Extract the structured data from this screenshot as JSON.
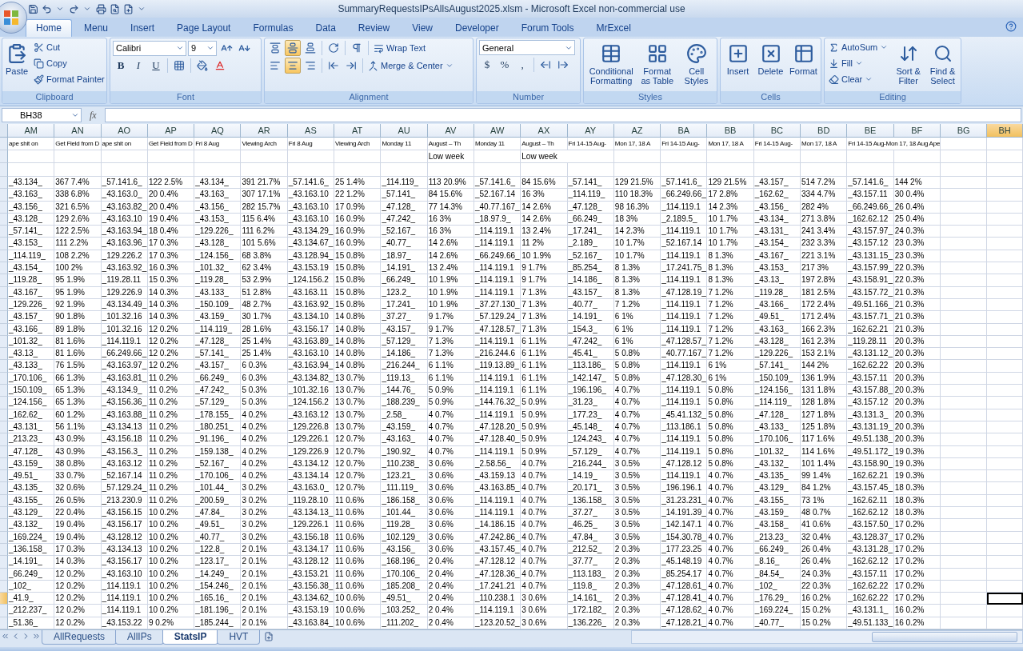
{
  "title_bar": {
    "title": "SummaryRequestsIPsAllsAugust2025.xlsm - Microsoft Excel non-commercial use"
  },
  "ribbon_tabs": [
    {
      "label": "Home",
      "selected": true
    },
    {
      "label": "Menu",
      "selected": false
    },
    {
      "label": "Insert",
      "selected": false
    },
    {
      "label": "Page Layout",
      "selected": false
    },
    {
      "label": "Formulas",
      "selected": false
    },
    {
      "label": "Data",
      "selected": false
    },
    {
      "label": "Review",
      "selected": false
    },
    {
      "label": "View",
      "selected": false
    },
    {
      "label": "Developer",
      "selected": false
    },
    {
      "label": "Forum Tools",
      "selected": false
    },
    {
      "label": "MrExcel",
      "selected": false
    }
  ],
  "ribbon": {
    "clipboard": {
      "paste": "Paste",
      "cut": "Cut",
      "copy": "Copy",
      "format_painter": "Format Painter",
      "label": "Clipboard"
    },
    "font": {
      "font_name": "Calibri",
      "font_size": "9",
      "style_buttons": [
        "B",
        "I",
        "U"
      ],
      "label": "Font"
    },
    "alignment": {
      "vertical_align": [
        {
          "selected": false
        },
        {
          "selected": true
        },
        {
          "selected": false
        }
      ],
      "horizontal_align": [
        {
          "selected": false
        },
        {
          "selected": true
        },
        {
          "selected": false
        }
      ],
      "wrap_text": "Wrap Text",
      "merge_center": "Merge & Center",
      "label": "Alignment"
    },
    "number": {
      "format": "General",
      "symbols": [
        "$",
        "%",
        ","
      ],
      "label": "Number"
    },
    "styles": {
      "buttons": [
        "Conditional Formatting",
        "Format as Table",
        "Cell Styles"
      ],
      "label": "Styles"
    },
    "cells": {
      "buttons": [
        "Insert",
        "Delete",
        "Format"
      ],
      "label": "Cells"
    },
    "editing": {
      "small": [
        "AutoSum",
        "Fill",
        "Clear"
      ],
      "large": [
        "Sort & Filter",
        "Find & Select"
      ],
      "label": "Editing"
    }
  },
  "formula_bar": {
    "name_box": "BH38",
    "fx": "fx"
  },
  "columns": [
    {
      "label": "AM",
      "selected": false
    },
    {
      "label": "AN",
      "selected": false
    },
    {
      "label": "AO",
      "selected": false
    },
    {
      "label": "AP",
      "selected": false
    },
    {
      "label": "AQ",
      "selected": false
    },
    {
      "label": "AR",
      "selected": false
    },
    {
      "label": "AS",
      "selected": false
    },
    {
      "label": "AT",
      "selected": false
    },
    {
      "label": "AU",
      "selected": false
    },
    {
      "label": "AV",
      "selected": false
    },
    {
      "label": "AW",
      "selected": false
    },
    {
      "label": "AX",
      "selected": false
    },
    {
      "label": "AY",
      "selected": false
    },
    {
      "label": "AZ",
      "selected": false
    },
    {
      "label": "BA",
      "selected": false
    },
    {
      "label": "BB",
      "selected": false
    },
    {
      "label": "BC",
      "selected": false
    },
    {
      "label": "BD",
      "selected": false
    },
    {
      "label": "BE",
      "selected": false
    },
    {
      "label": "BF",
      "selected": false
    },
    {
      "label": "BG",
      "selected": false
    },
    {
      "label": "BH",
      "selected": true
    }
  ],
  "header_rows": [
    {
      "cells": [
        "ape shit on",
        "Get Field from D",
        "ape shit on",
        "Get Field from D",
        "Fri 8 Aug",
        "Viewing Arch",
        "Fri 8 Aug",
        "Viewing Arch",
        "Monday 11",
        "August – Th",
        "Monday 11",
        "August – Th",
        "Fri 14-15 Aug-",
        "Mon 17, 18 A",
        "Fri 14-15 Aug-",
        "Mon 17, 18 A",
        "Fri 14-15 Aug-",
        "Mon 17, 18 A",
        "Fri 14-15 Aug-Mon 17, 18 Aug Ape"
      ]
    },
    {
      "cells": [
        null,
        null,
        null,
        null,
        null,
        null,
        null,
        null,
        null,
        "Low week",
        null,
        "Low week"
      ]
    }
  ],
  "rows": [
    {
      "selected": false,
      "cells": [
        "_43.134_",
        "367 7.4%",
        "_57.141.6_",
        "122 2.5%",
        "_43.134_",
        "391 21.7%",
        "_57.141.6_",
        "25 1.4%",
        "_114.119_",
        "113 20.9%",
        "_57.141.6_",
        "84 15.6%",
        "_57.141_",
        "129 21.5%",
        "_57.141.6_",
        "129 21.5%",
        "_43.157_",
        "514 7.2%",
        "_57.141.6_",
        "144 2%"
      ]
    },
    {
      "selected": false,
      "cells": [
        "_43.163_",
        "338 6.8%",
        "_43.163.0_",
        "20 0.4%",
        "_43.163_",
        "307 17.1%",
        "_43.163.10",
        "22 1.2%",
        "_57.141_",
        "84 15.6%",
        "_52.167.14",
        "16 3%",
        "_114.119_",
        "110 18.3%",
        "_66.249.66_",
        "17 2.8%",
        "_162.62_",
        "334 4.7%",
        "_43.157.11",
        "30 0.4%"
      ]
    },
    {
      "selected": false,
      "cells": [
        "_43.156_",
        "321 6.5%",
        "_43.163.82_",
        "20 0.4%",
        "_43.156_",
        "282 15.7%",
        "_43.163.10",
        "17 0.9%",
        "_47.128_",
        "77 14.3%",
        "_40.77.167_",
        "14 2.6%",
        "_47.128_",
        "98 16.3%",
        "_114.119.1",
        "14 2.3%",
        "_43.156_",
        "282 4%",
        "_66.249.66_",
        "26 0.4%"
      ]
    },
    {
      "selected": false,
      "cells": [
        "_43.128_",
        "129 2.6%",
        "_43.163.10",
        "19 0.4%",
        "_43.153_",
        "115 6.4%",
        "_43.163.10",
        "16 0.9%",
        "_47.242_",
        "16 3%",
        "_18.97.9_",
        "14 2.6%",
        "_66.249_",
        "18 3%",
        "_2.189.5_",
        "10 1.7%",
        "_43.134_",
        "271 3.8%",
        "_162.62.12",
        "25 0.4%"
      ]
    },
    {
      "selected": false,
      "cells": [
        "_57.141_",
        "122 2.5%",
        "_43.163.94_",
        "18 0.4%",
        "_129.226_",
        "111 6.2%",
        "_43.134.29_",
        "16 0.9%",
        "_52.167_",
        "16 3%",
        "_114.119.1",
        "13 2.4%",
        "_17.241_",
        "14 2.3%",
        "_114.119.1",
        "10 1.7%",
        "_43.131_",
        "241 3.4%",
        "_43.157.97_",
        "24 0.3%"
      ]
    },
    {
      "selected": false,
      "cells": [
        "_43.153_",
        "111 2.2%",
        "_43.163.96_",
        "17 0.3%",
        "_43.128_",
        "101 5.6%",
        "_43.134.67_",
        "16 0.9%",
        "_40.77_",
        "14 2.6%",
        "_114.119.1",
        "11 2%",
        "_2.189_",
        "10 1.7%",
        "_52.167.14",
        "10 1.7%",
        "_43.154_",
        "232 3.3%",
        "_43.157.12",
        "23 0.3%"
      ]
    },
    {
      "selected": false,
      "cells": [
        "_114.119_",
        "108 2.2%",
        "_129.226.2",
        "17 0.3%",
        "_124.156_",
        "68 3.8%",
        "_43.128.94_",
        "15 0.8%",
        "_18.97_",
        "14 2.6%",
        "_66.249.66_",
        "10 1.9%",
        "_52.167_",
        "10 1.7%",
        "_114.119.1",
        "8 1.3%",
        "_43.167_",
        "221 3.1%",
        "_43.131.15_",
        "23 0.3%"
      ]
    },
    {
      "selected": false,
      "cells": [
        "_43.154_",
        "100 2%",
        "_43.163.92_",
        "16 0.3%",
        "_101.32_",
        "62 3.4%",
        "_43.153.19",
        "15 0.8%",
        "_14.191_",
        "13 2.4%",
        "_114.119.1",
        "9 1.7%",
        "_85.254_",
        "8 1.3%",
        "_17.241.75_",
        "8 1.3%",
        "_43.153_",
        "217 3%",
        "_43.157.99_",
        "22 0.3%"
      ]
    },
    {
      "selected": false,
      "cells": [
        "_119.28_",
        "95 1.9%",
        "_119.28.11",
        "15 0.3%",
        "_119.28_",
        "53 2.9%",
        "_124.156.2",
        "15 0.8%",
        "_66.249_",
        "10 1.9%",
        "_114.119.1",
        "9 1.7%",
        "_14.186_",
        "8 1.3%",
        "_114.119.1",
        "8 1.3%",
        "_43.13_",
        "197 2.8%",
        "_43.158.91_",
        "22 0.3%"
      ]
    },
    {
      "selected": false,
      "cells": [
        "_43.167_",
        "95 1.9%",
        "_129.226.9",
        "14 0.3%",
        "_43.133_",
        "51 2.8%",
        "_43.163.11",
        "15 0.8%",
        "_123.2_",
        "10 1.9%",
        "_114.119.1",
        "7 1.3%",
        "_43.157_",
        "8 1.3%",
        "_47.128.19_",
        "7 1.2%",
        "_119.28_",
        "181 2.5%",
        "_43.157.72_",
        "21 0.3%"
      ]
    },
    {
      "selected": false,
      "cells": [
        "_129.226_",
        "92 1.9%",
        "_43.134.49_",
        "14 0.3%",
        "_150.109_",
        "48 2.7%",
        "_43.163.92_",
        "15 0.8%",
        "_17.241_",
        "10 1.9%",
        "_37.27.130_",
        "7 1.3%",
        "_40.77_",
        "7 1.2%",
        "_114.119.1",
        "7 1.2%",
        "_43.166_",
        "172 2.4%",
        "_49.51.166_",
        "21 0.3%"
      ]
    },
    {
      "selected": false,
      "cells": [
        "_43.157_",
        "90 1.8%",
        "_101.32.16",
        "14 0.3%",
        "_43.159_",
        "30 1.7%",
        "_43.134.10",
        "14 0.8%",
        "_37.27_",
        "9 1.7%",
        "_57.129.24_",
        "7 1.3%",
        "_14.191_",
        "6 1%",
        "_114.119.1",
        "7 1.2%",
        "_49.51_",
        "171 2.4%",
        "_43.157.71_",
        "21 0.3%"
      ]
    },
    {
      "selected": false,
      "cells": [
        "_43.166_",
        "89 1.8%",
        "_101.32.16",
        "12 0.2%",
        "_114.119_",
        "28 1.6%",
        "_43.156.17",
        "14 0.8%",
        "_43.157_",
        "9 1.7%",
        "_47.128.57_",
        "7 1.3%",
        "_154.3_",
        "6 1%",
        "_114.119.1",
        "7 1.2%",
        "_43.163_",
        "166 2.3%",
        "_162.62.21",
        "21 0.3%"
      ]
    },
    {
      "selected": false,
      "cells": [
        "_101.32_",
        "81 1.6%",
        "_114.119.1",
        "12 0.2%",
        "_47.128_",
        "25 1.4%",
        "_43.163.89_",
        "14 0.8%",
        "_57.129_",
        "7 1.3%",
        "_114.119.1",
        "6 1.1%",
        "_47.242_",
        "6 1%",
        "_47.128.57_",
        "7 1.2%",
        "_43.128_",
        "161 2.3%",
        "_119.28.11",
        "20 0.3%"
      ]
    },
    {
      "selected": false,
      "cells": [
        "_43.13_",
        "81 1.6%",
        "_66.249.66_",
        "12 0.2%",
        "_57.141_",
        "25 1.4%",
        "_43.163.10",
        "14 0.8%",
        "_14.186_",
        "7 1.3%",
        "_216.244.6",
        "6 1.1%",
        "_45.41_",
        "5 0.8%",
        "_40.77.167_",
        "7 1.2%",
        "_129.226_",
        "153 2.1%",
        "_43.131.12_",
        "20 0.3%"
      ]
    },
    {
      "selected": false,
      "cells": [
        "_43.133_",
        "76 1.5%",
        "_43.163.97_",
        "12 0.2%",
        "_43.157_",
        "6 0.3%",
        "_43.163.94_",
        "14 0.8%",
        "_216.244_",
        "6 1.1%",
        "_119.13.89_",
        "6 1.1%",
        "_113.186_",
        "5 0.8%",
        "_114.119.1",
        "6 1%",
        "_57.141_",
        "144 2%",
        "_162.62.22",
        "20 0.3%"
      ]
    },
    {
      "selected": false,
      "cells": [
        "_170.106_",
        "66 1.3%",
        "_43.163.81_",
        "11 0.2%",
        "_66.249_",
        "6 0.3%",
        "_43.134.82_",
        "13 0.7%",
        "_119.13_",
        "6 1.1%",
        "_114.119.1",
        "6 1.1%",
        "_142.147_",
        "5 0.8%",
        "_47.128.30_",
        "6 1%",
        "_150.109_",
        "136 1.9%",
        "_43.157.11",
        "20 0.3%"
      ]
    },
    {
      "selected": false,
      "cells": [
        "_150.109_",
        "65 1.3%",
        "_43.134.9_",
        "11 0.2%",
        "_47.242_",
        "5 0.3%",
        "_101.32.16",
        "13 0.7%",
        "_144.76_",
        "5 0.9%",
        "_114.119.1",
        "6 1.1%",
        "_196.196_",
        "4 0.7%",
        "_114.119.1",
        "5 0.8%",
        "_124.156_",
        "131 1.8%",
        "_43.157.88_",
        "20 0.3%"
      ]
    },
    {
      "selected": false,
      "cells": [
        "_124.156_",
        "65 1.3%",
        "_43.156.36_",
        "11 0.2%",
        "_57.129_",
        "5 0.3%",
        "_124.156.2",
        "13 0.7%",
        "_188.239_",
        "5 0.9%",
        "_144.76.32_",
        "5 0.9%",
        "_31.23_",
        "4 0.7%",
        "_114.119.1",
        "5 0.8%",
        "_114.119_",
        "128 1.8%",
        "_43.157.12",
        "20 0.3%"
      ]
    },
    {
      "selected": false,
      "cells": [
        "_162.62_",
        "60 1.2%",
        "_43.163.88_",
        "11 0.2%",
        "_178.155_",
        "4 0.2%",
        "_43.163.12",
        "13 0.7%",
        "_2.58_",
        "4 0.7%",
        "_114.119.1",
        "5 0.9%",
        "_177.23_",
        "4 0.7%",
        "_45.41.132_",
        "5 0.8%",
        "_47.128_",
        "127 1.8%",
        "_43.131.3_",
        "20 0.3%"
      ]
    },
    {
      "selected": false,
      "cells": [
        "_43.131_",
        "56 1.1%",
        "_43.134.13",
        "11 0.2%",
        "_180.251_",
        "4 0.2%",
        "_129.226.8",
        "13 0.7%",
        "_43.159_",
        "4 0.7%",
        "_47.128.20_",
        "5 0.9%",
        "_45.148_",
        "4 0.7%",
        "_113.186.1",
        "5 0.8%",
        "_43.133_",
        "125 1.8%",
        "_43.131.19_",
        "20 0.3%"
      ]
    },
    {
      "selected": false,
      "cells": [
        "_213.23_",
        "43 0.9%",
        "_43.156.18",
        "11 0.2%",
        "_91.196_",
        "4 0.2%",
        "_129.226.1",
        "12 0.7%",
        "_43.163_",
        "4 0.7%",
        "_47.128.40_",
        "5 0.9%",
        "_124.243_",
        "4 0.7%",
        "_114.119.1",
        "5 0.8%",
        "_170.106_",
        "117 1.6%",
        "_49.51.138_",
        "20 0.3%"
      ]
    },
    {
      "selected": false,
      "cells": [
        "_47.128_",
        "43 0.9%",
        "_43.156.3_",
        "11 0.2%",
        "_159.138_",
        "4 0.2%",
        "_129.226.9",
        "12 0.7%",
        "_190.92_",
        "4 0.7%",
        "_114.119.1",
        "5 0.9%",
        "_57.129_",
        "4 0.7%",
        "_114.119.1",
        "5 0.8%",
        "_101.32_",
        "114 1.6%",
        "_49.51.172_",
        "19 0.3%"
      ]
    },
    {
      "selected": false,
      "cells": [
        "_43.159_",
        "38 0.8%",
        "_43.163.12",
        "11 0.2%",
        "_52.167_",
        "4 0.2%",
        "_43.134.12",
        "12 0.7%",
        "_110.238_",
        "3 0.6%",
        "_2.58.56_",
        "4 0.7%",
        "_216.244_",
        "3 0.5%",
        "_47.128.12",
        "5 0.8%",
        "_43.132_",
        "101 1.4%",
        "_43.158.90_",
        "19 0.3%"
      ]
    },
    {
      "selected": false,
      "cells": [
        "_49.51_",
        "33 0.7%",
        "_52.167.14",
        "11 0.2%",
        "_170.106_",
        "4 0.2%",
        "_43.134.14",
        "12 0.7%",
        "_123.21_",
        "3 0.6%",
        "_43.159.13",
        "4 0.7%",
        "_14.19_",
        "3 0.5%",
        "_114.119.1",
        "4 0.7%",
        "_43.135_",
        "99 1.4%",
        "_162.62.21",
        "19 0.3%"
      ]
    },
    {
      "selected": false,
      "cells": [
        "_43.135_",
        "32 0.6%",
        "_57.129.24_",
        "11 0.2%",
        "_101.44_",
        "3 0.2%",
        "_43.163.0_",
        "12 0.7%",
        "_111.119_",
        "3 0.6%",
        "_43.163.85_",
        "4 0.7%",
        "_20.171_",
        "3 0.5%",
        "_196.196.1",
        "4 0.7%",
        "_43.129_",
        "84 1.2%",
        "_43.157.45_",
        "18 0.3%"
      ]
    },
    {
      "selected": false,
      "cells": [
        "_43.155_",
        "26 0.5%",
        "_213.230.9",
        "11 0.2%",
        "_200.59_",
        "3 0.2%",
        "_119.28.10",
        "11 0.6%",
        "_186.158_",
        "3 0.6%",
        "_114.119.1",
        "4 0.7%",
        "_136.158_",
        "3 0.5%",
        "_31.23.231_",
        "4 0.7%",
        "_43.155_",
        "73 1%",
        "_162.62.11",
        "18 0.3%"
      ]
    },
    {
      "selected": false,
      "cells": [
        "_43.129_",
        "22 0.4%",
        "_43.156.15",
        "10 0.2%",
        "_47.84_",
        "3 0.2%",
        "_43.134.13_",
        "11 0.6%",
        "_101.44_",
        "3 0.6%",
        "_114.119.1",
        "4 0.7%",
        "_37.27_",
        "3 0.5%",
        "_14.191.39_",
        "4 0.7%",
        "_43.159_",
        "48 0.7%",
        "_162.62.12",
        "18 0.3%"
      ]
    },
    {
      "selected": false,
      "cells": [
        "_43.132_",
        "19 0.4%",
        "_43.156.17",
        "10 0.2%",
        "_49.51_",
        "3 0.2%",
        "_129.226.1",
        "11 0.6%",
        "_119.28_",
        "3 0.6%",
        "_14.186.15",
        "4 0.7%",
        "_46.25_",
        "3 0.5%",
        "_142.147.1",
        "4 0.7%",
        "_43.158_",
        "41 0.6%",
        "_43.157.50_",
        "17 0.2%"
      ]
    },
    {
      "selected": false,
      "cells": [
        "_169.224_",
        "19 0.4%",
        "_43.128.12",
        "10 0.2%",
        "_40.77_",
        "3 0.2%",
        "_43.156.18",
        "11 0.6%",
        "_102.129_",
        "3 0.6%",
        "_47.242.86_",
        "4 0.7%",
        "_47.84_",
        "3 0.5%",
        "_154.30.78_",
        "4 0.7%",
        "_213.23_",
        "32 0.4%",
        "_43.128.37_",
        "17 0.2%"
      ]
    },
    {
      "selected": false,
      "cells": [
        "_136.158_",
        "17 0.3%",
        "_43.134.13",
        "10 0.2%",
        "_122.8_",
        "2 0.1%",
        "_43.134.17",
        "11 0.6%",
        "_43.156_",
        "3 0.6%",
        "_43.157.45_",
        "4 0.7%",
        "_212.52_",
        "2 0.3%",
        "_177.23.25",
        "4 0.7%",
        "_66.249_",
        "26 0.4%",
        "_43.131.28_",
        "17 0.2%"
      ]
    },
    {
      "selected": false,
      "cells": [
        "_14.191_",
        "14 0.3%",
        "_43.156.17",
        "10 0.2%",
        "_123.17_",
        "2 0.1%",
        "_43.128.12",
        "11 0.6%",
        "_168.196_",
        "2 0.4%",
        "_47.128.12",
        "4 0.7%",
        "_37.77_",
        "2 0.3%",
        "_45.148.19",
        "4 0.7%",
        "_8.16_",
        "26 0.4%",
        "_162.62.12",
        "17 0.2%"
      ]
    },
    {
      "selected": false,
      "cells": [
        "_66.249_",
        "12 0.2%",
        "_43.163.10",
        "10 0.2%",
        "_14.249_",
        "2 0.1%",
        "_43.153.21",
        "11 0.6%",
        "_170.106_",
        "2 0.4%",
        "_47.128.36_",
        "4 0.7%",
        "_113.183_",
        "2 0.3%",
        "_85.254.17",
        "4 0.7%",
        "_84.54_",
        "24 0.3%",
        "_43.157.11",
        "17 0.2%"
      ]
    },
    {
      "selected": false,
      "cells": [
        "_102_",
        "12 0.2%",
        "_114.119.1",
        "10 0.2%",
        "_154.246_",
        "2 0.1%",
        "_43.156.38_",
        "11 0.6%",
        "_185.208_",
        "2 0.4%",
        "_17.241.21",
        "4 0.7%",
        "_119.8_",
        "2 0.3%",
        "_47.128.61_",
        "4 0.7%",
        "_102_",
        "22 0.3%",
        "_162.62.22",
        "17 0.2%"
      ]
    },
    {
      "selected": true,
      "cells": [
        "_41.9_",
        "12 0.2%",
        "_114.119.1",
        "10 0.2%",
        "_165.16_",
        "2 0.1%",
        "_43.134.62_",
        "10 0.6%",
        "_49.51_",
        "2 0.4%",
        "_110.238.1",
        "3 0.6%",
        "_14.161_",
        "2 0.3%",
        "_47.128.41_",
        "4 0.7%",
        "_176.29_",
        "16 0.2%",
        "_162.62.22",
        "17 0.2%"
      ]
    },
    {
      "selected": false,
      "cells": [
        "_212.237_",
        "12 0.2%",
        "_114.119.1",
        "10 0.2%",
        "_181.196_",
        "2 0.1%",
        "_43.153.19",
        "10 0.6%",
        "_103.252_",
        "2 0.4%",
        "_114.119.1",
        "3 0.6%",
        "_172.182_",
        "2 0.3%",
        "_47.128.62_",
        "4 0.7%",
        "_169.224_",
        "15 0.2%",
        "_43.131.1_",
        "16 0.2%"
      ]
    },
    {
      "selected": false,
      "cells": [
        "_51.36_",
        "12 0.2%",
        "_43.153.22",
        "9 0.2%",
        "_185.244_",
        "2 0.1%",
        "_43.163.84_",
        "10 0.6%",
        "_111.202_",
        "2 0.4%",
        "_123.20.52_",
        "3 0.6%",
        "_136.226_",
        "2 0.3%",
        "_47.128.21_",
        "4 0.7%",
        "_40.77_",
        "15 0.2%",
        "_49.51.133_",
        "16 0.2%"
      ]
    }
  ],
  "sheet_tabs": [
    {
      "label": "AllRequests",
      "selected": false
    },
    {
      "label": "AllIPs",
      "selected": false
    },
    {
      "label": "StatsIP",
      "selected": true
    },
    {
      "label": "HVT",
      "selected": false
    }
  ]
}
